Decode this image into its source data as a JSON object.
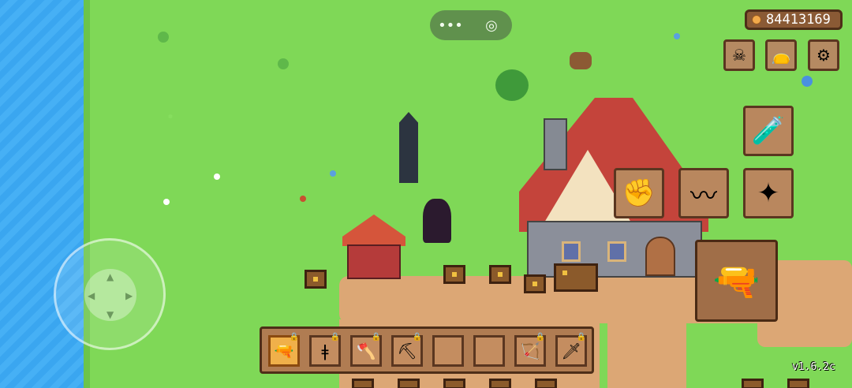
{
  "top_pill": {
    "menu_icon": "•••",
    "record_icon": "◎"
  },
  "coins": {
    "icon": "coin-icon",
    "value": "84413169"
  },
  "top_buttons": [
    {
      "name": "skull-icon",
      "glyph": "☠"
    },
    {
      "name": "bag-icon",
      "glyph": "👝"
    },
    {
      "name": "settings-icon",
      "glyph": "⚙"
    }
  ],
  "skills": [
    {
      "name": "potion-icon",
      "glyph": "🧪"
    },
    {
      "name": "gauntlet-icon",
      "glyph": "✊"
    },
    {
      "name": "slash-icon",
      "glyph": "〰"
    },
    {
      "name": "dash-icon",
      "glyph": "✦"
    }
  ],
  "attack_button": {
    "name": "gun-icon",
    "glyph": "🔫"
  },
  "hotbar": [
    {
      "name": "gun-slot",
      "glyph": "🔫",
      "selected": true,
      "locked": true
    },
    {
      "name": "staff-slot",
      "glyph": "ǂ",
      "selected": false,
      "locked": true
    },
    {
      "name": "axe-slot",
      "glyph": "🪓",
      "selected": false,
      "locked": true
    },
    {
      "name": "pickaxe-slot",
      "glyph": "⛏",
      "selected": false,
      "locked": true
    },
    {
      "name": "empty-slot",
      "glyph": "",
      "selected": false,
      "locked": false
    },
    {
      "name": "empty-slot",
      "glyph": "",
      "selected": false,
      "locked": false
    },
    {
      "name": "bow-slot",
      "glyph": "🏹",
      "selected": false,
      "locked": true
    },
    {
      "name": "sword-slot",
      "glyph": "🗡",
      "selected": false,
      "locked": true
    }
  ],
  "lock_glyph": "🔒",
  "dpad": {
    "up": "▲",
    "down": "▼",
    "left": "◀",
    "right": "▶"
  },
  "version": "v1.6.2c"
}
